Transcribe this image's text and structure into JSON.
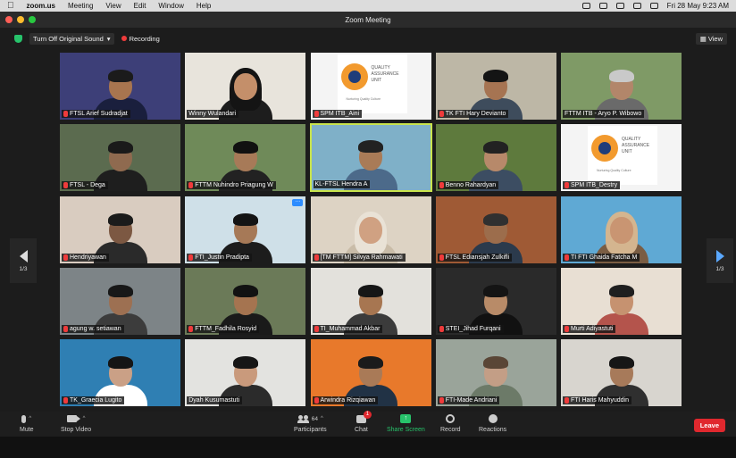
{
  "menubar": {
    "app": "zoom.us",
    "items": [
      "Meeting",
      "View",
      "Edit",
      "Window",
      "Help"
    ],
    "datetime": "Fri 28 May 9:23 AM"
  },
  "window": {
    "title": "Zoom Meeting"
  },
  "controls": {
    "sound_label": "Turn Off Original Sound",
    "recording_label": "Recording",
    "view_label": "View"
  },
  "pager": {
    "left": "1/3",
    "right": "1/3"
  },
  "participants": [
    {
      "name": "FTSL Arief Sudradjat",
      "muted": true,
      "bg": "#3d3f78",
      "skin": "#a8754f",
      "hair": "#1b1b1b",
      "shirt": "#1a1f3d"
    },
    {
      "name": "Winny Wulandari",
      "muted": false,
      "bg": "#e8e4dc",
      "skin": "#c48f6a",
      "hair": "#141414",
      "shirt": "#1d1d1d",
      "hijab": true
    },
    {
      "name": "SPM ITB_Aini",
      "muted": true,
      "bg": "#f4f4f4",
      "card": true
    },
    {
      "name": "TK FTI Hary Devianto",
      "muted": true,
      "bg": "#bdb7a6",
      "skin": "#a67452",
      "hair": "#141414",
      "shirt": "#3e4c5c"
    },
    {
      "name": "FTTM ITB - Aryo P. Wibowo",
      "muted": false,
      "bg": "#7f9a66",
      "skin": "#b2866a",
      "hair": "#c9c9c9",
      "shirt": "#6a6a6a"
    },
    {
      "name": "FTSL - Dega",
      "muted": true,
      "bg": "#5b6b4f",
      "skin": "#8f6a4f",
      "hair": "#1a1a1a",
      "shirt": "#1e1e1e"
    },
    {
      "name": "FTTM Nuhindro Priagung W",
      "muted": true,
      "bg": "#6f8a59",
      "skin": "#a77a58",
      "hair": "#111",
      "shirt": "#222"
    },
    {
      "name": "KL-FTSL Hendra A",
      "muted": false,
      "bg": "#7fb0c8",
      "skin": "#a97b57",
      "hair": "#222",
      "shirt": "#4c6a8a",
      "active": true
    },
    {
      "name": "Benno Rahardyan",
      "muted": true,
      "bg": "#5e7a3d",
      "skin": "#b7896a",
      "hair": "#222",
      "shirt": "#3c4d62"
    },
    {
      "name": "SPM ITB_Destry",
      "muted": true,
      "bg": "#f4f4f4",
      "card": true
    },
    {
      "name": "Hendriyawan",
      "muted": true,
      "bg": "#d9ccc0",
      "skin": "#7c5842",
      "hair": "#1b1b1b",
      "shirt": "#2a2a2a"
    },
    {
      "name": "FTI_Justin Pradipta",
      "muted": true,
      "bg": "#cfe0e8",
      "skin": "#a67957",
      "hair": "#141414",
      "shirt": "#1c1c1c",
      "more": true
    },
    {
      "name": "[TM FTTM] Silvya Rahmawati",
      "muted": true,
      "bg": "#ddd3c4",
      "skin": "#d0a182",
      "hair": "#e9e2d6",
      "shirt": "#c9bca8",
      "hijab": true
    },
    {
      "name": "FTSL Ediansjah Zulkifli",
      "muted": true,
      "bg": "#9f5a35",
      "skin": "#9c6d4c",
      "hair": "#303030",
      "shirt": "#2b3a4c"
    },
    {
      "name": "TI FTI Ghaida Fatcha M",
      "muted": true,
      "bg": "#5fa9d4",
      "skin": "#c99572",
      "hair": "#d4b58f",
      "shirt": "#7a5d43",
      "hijab": true
    },
    {
      "name": "agung w. setiawan",
      "muted": true,
      "bg": "#7d8487",
      "skin": "#9d7052",
      "hair": "#181818",
      "shirt": "#3c3c3c"
    },
    {
      "name": "FTTM_Fadhila Rosyid",
      "muted": true,
      "bg": "#6b7a58",
      "skin": "#a57450",
      "hair": "#121212",
      "shirt": "#1a1a1a"
    },
    {
      "name": "TI_Muhammad Akbar",
      "muted": true,
      "bg": "#e3e1dc",
      "skin": "#a77651",
      "hair": "#161616",
      "shirt": "#3b3b3b"
    },
    {
      "name": "STEI_Jihad Furqani",
      "muted": true,
      "bg": "#2a2a2a",
      "skin": "#b88b68",
      "hair": "#141414",
      "shirt": "#111"
    },
    {
      "name": "Murti Adiyastuti",
      "muted": true,
      "bg": "#e8dfd3",
      "skin": "#c69270",
      "hair": "#1f1f1f",
      "shirt": "#b4544c"
    },
    {
      "name": "TK_Graecia Lugito",
      "muted": true,
      "bg": "#2f7fb3",
      "skin": "#caa086",
      "hair": "#151515",
      "shirt": "#ffffff"
    },
    {
      "name": "Dyah Kusumastuti",
      "muted": false,
      "bg": "#e3e3e0",
      "skin": "#c99a7c",
      "hair": "#161616",
      "shirt": "#2b2b2b"
    },
    {
      "name": "Arwindra Rizqiawan",
      "muted": true,
      "bg": "#e8792b",
      "skin": "#a97a57",
      "hair": "#1b1b1b",
      "shirt": "#213245"
    },
    {
      "name": "FTI-Made Andriani",
      "muted": true,
      "bg": "#9aa49a",
      "skin": "#c39e86",
      "hair": "#5a4636",
      "shirt": "#6c7a68"
    },
    {
      "name": "FTI Haris Mahyuddin",
      "muted": true,
      "bg": "#d8d5cf",
      "skin": "#a77a5a",
      "hair": "#161616",
      "shirt": "#2f2f2f"
    }
  ],
  "qa_card": {
    "title": "QUALITY\nASSURANCE\nUNIT",
    "subtitle": "Nurturing Quality Culture"
  },
  "toolbar": {
    "mute": "Mute",
    "stop_video": "Stop Video",
    "participants": "Participants",
    "participants_count": "64",
    "chat": "Chat",
    "chat_badge": "1",
    "share": "Share Screen",
    "record": "Record",
    "reactions": "Reactions",
    "leave": "Leave"
  },
  "colors": {
    "active_speaker": "#c9e44c",
    "share_green": "#27c36b",
    "leave_red": "#e0282e",
    "mic_red": "#ef3b3b"
  }
}
